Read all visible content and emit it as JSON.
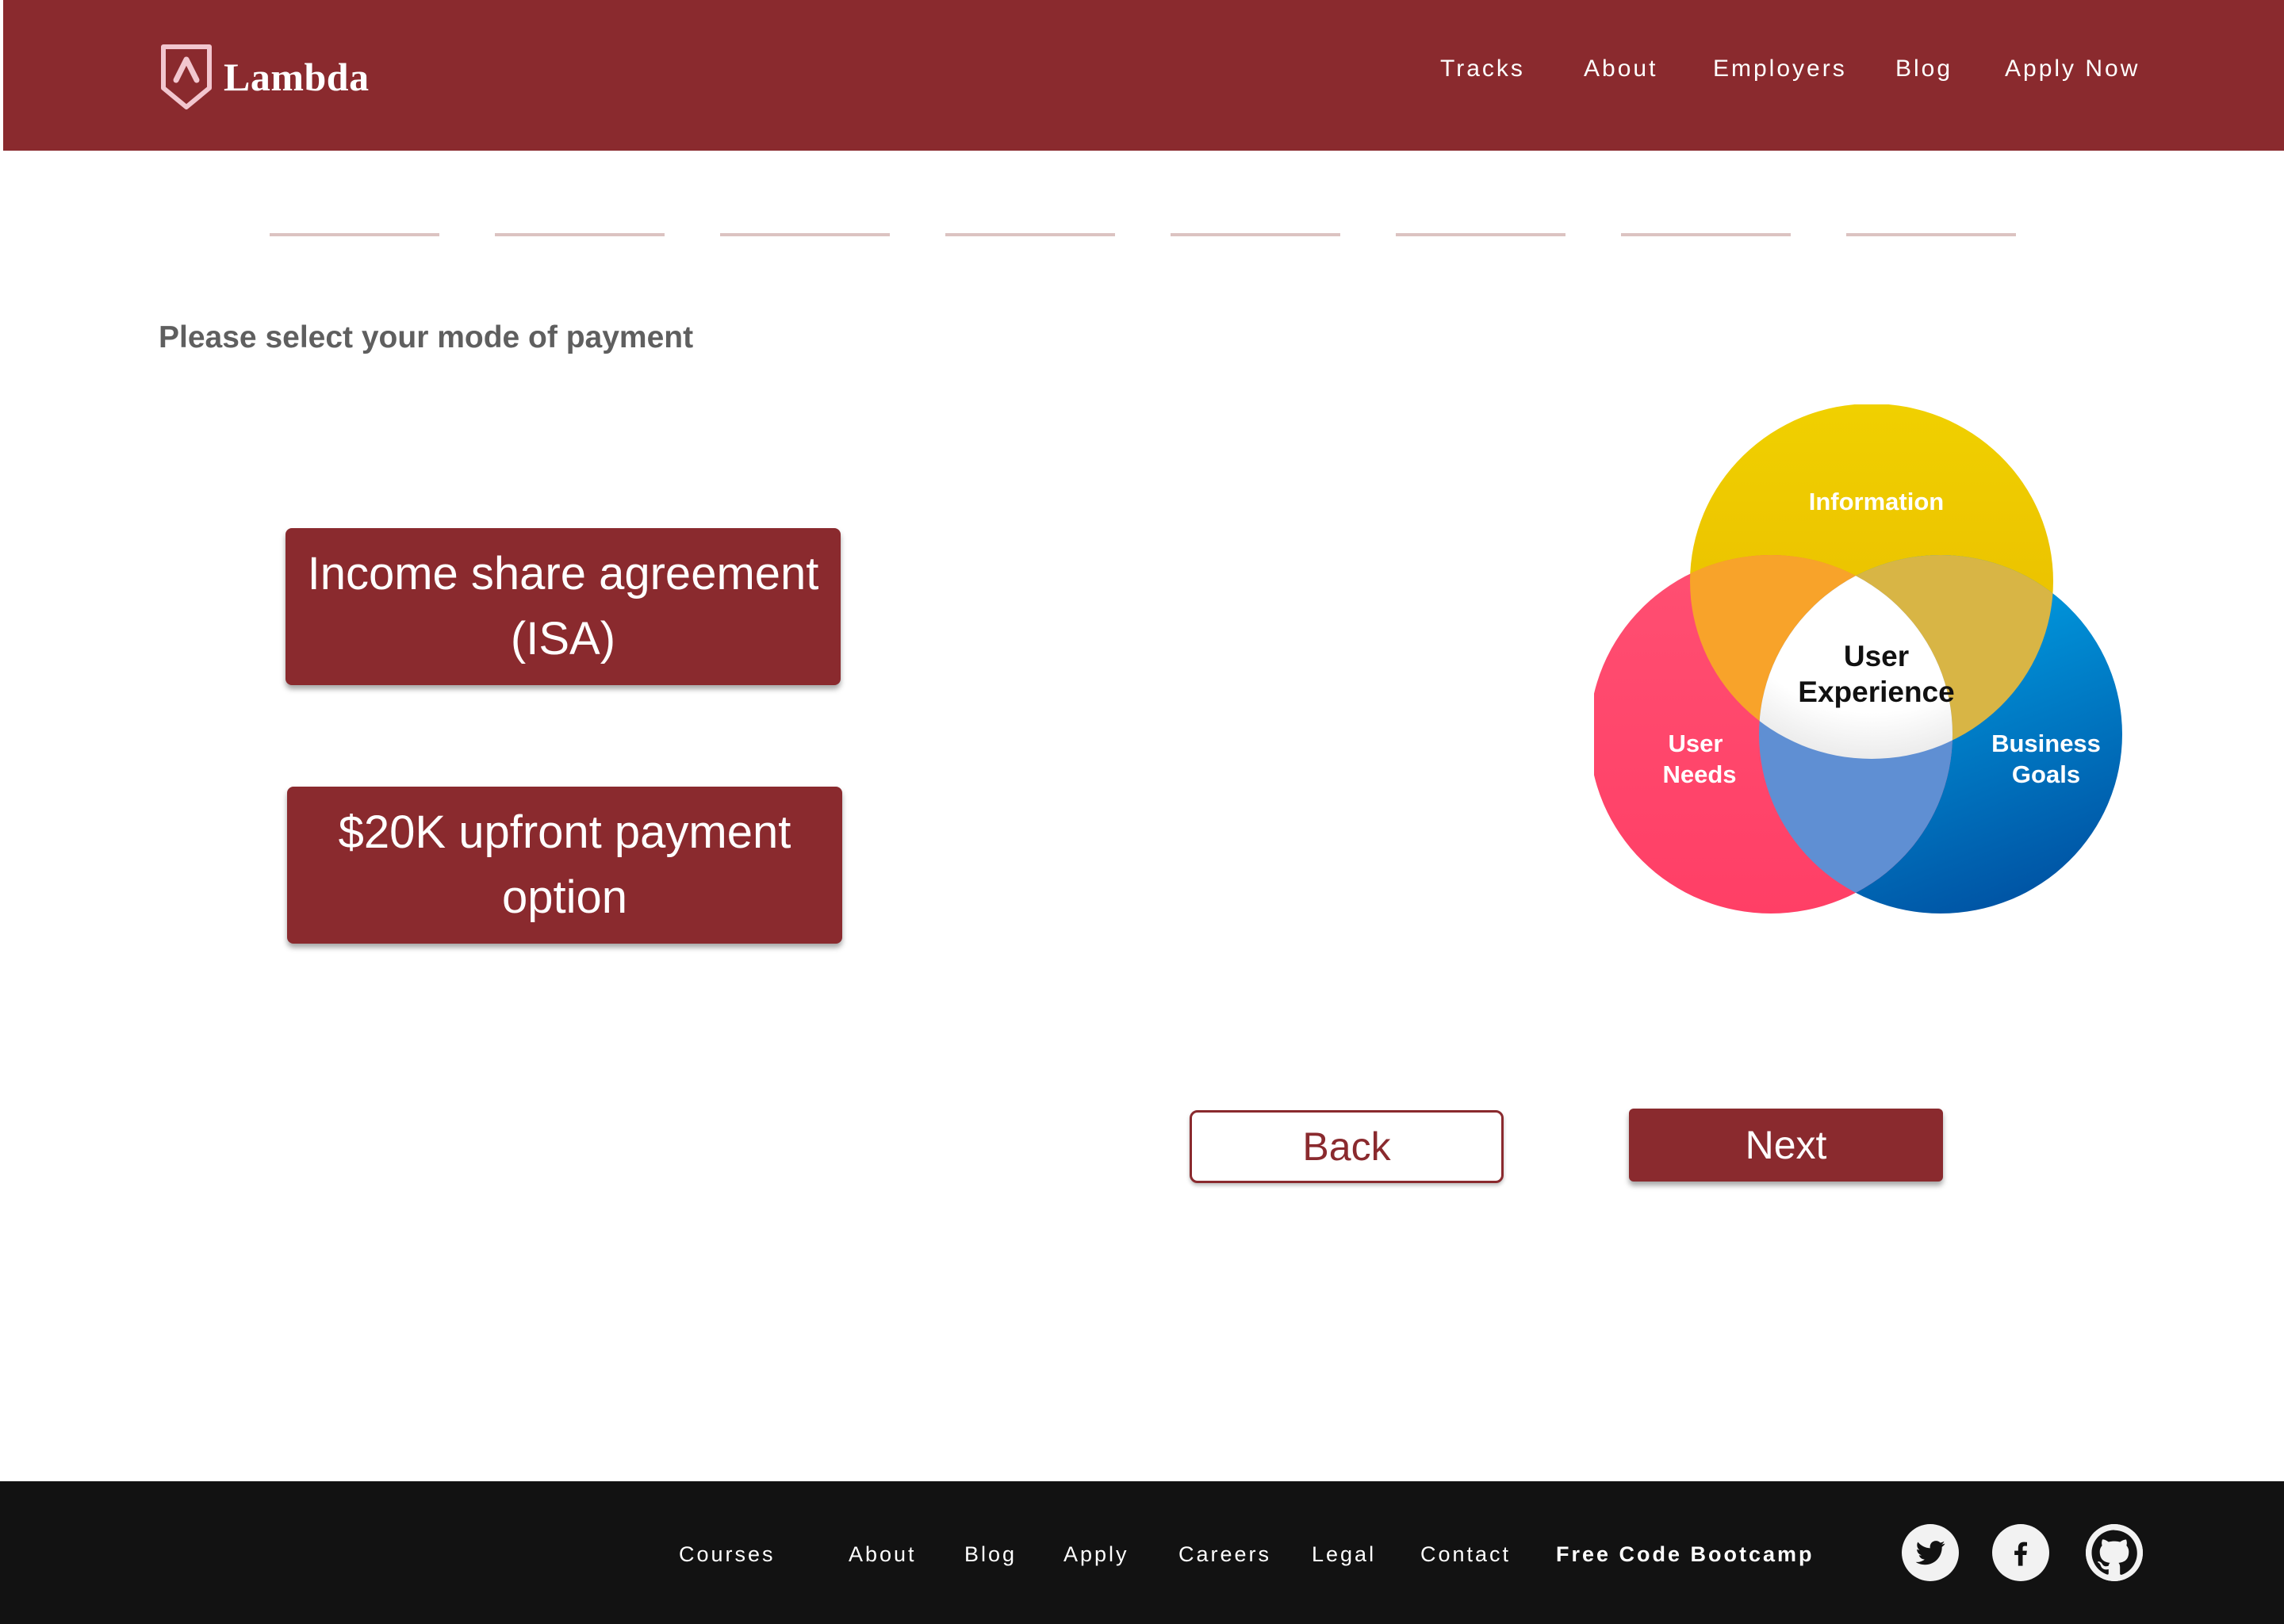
{
  "header": {
    "logo_text": "Lambda",
    "nav": [
      "Tracks",
      "About",
      "Employers",
      "Blog",
      "Apply Now"
    ]
  },
  "progress": {
    "total_steps": 8
  },
  "main": {
    "prompt": "Please select your mode of payment",
    "options": [
      {
        "line1": "Income share agreement",
        "line2": "(ISA)"
      },
      {
        "line1": "$20K upfront payment",
        "line2": "option"
      }
    ],
    "back_label": "Back",
    "next_label": "Next"
  },
  "venn": {
    "top": "Information",
    "left_line1": "User",
    "left_line2": "Needs",
    "right_line1": "Business",
    "right_line2": "Goals",
    "center_line1": "User",
    "center_line2": "Experience"
  },
  "footer": {
    "links": [
      "Courses",
      "About",
      "Blog",
      "Apply",
      "Careers",
      "Legal",
      "Contact"
    ],
    "highlight": "Free Code Bootcamp",
    "social": [
      "twitter-icon",
      "facebook-icon",
      "github-icon"
    ]
  },
  "colors": {
    "brand": "#8a2a2e",
    "footer": "#121212",
    "prompt": "#5f5f5f",
    "progress": "#dcc3c1"
  }
}
